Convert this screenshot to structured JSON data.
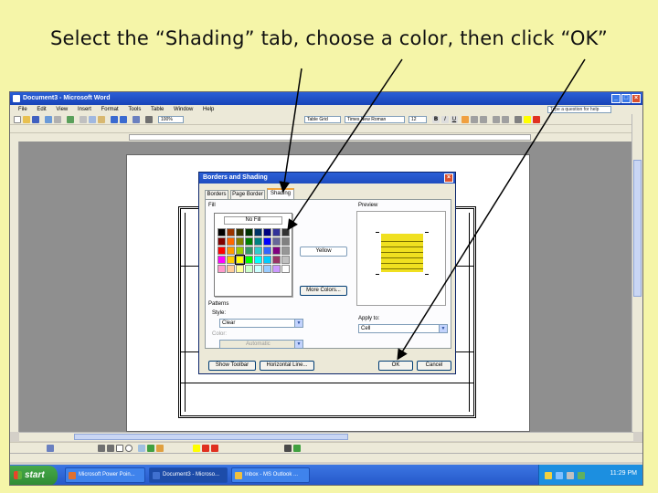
{
  "caption": "Select the “Shading” tab, choose a color, then click “OK”",
  "window": {
    "title": "Document3 - Microsoft Word",
    "menu": [
      "File",
      "Edit",
      "View",
      "Insert",
      "Format",
      "Tools",
      "Table",
      "Window",
      "Help"
    ],
    "help_placeholder": "Type a question for help",
    "style_box": "Table Grid",
    "font_box": "Times New Roman",
    "size_box": "12",
    "zoom_box": "100%"
  },
  "dialog": {
    "title": "Borders and Shading",
    "tabs": [
      "Borders",
      "Page Border",
      "Shading"
    ],
    "active_tab": "Shading",
    "fill_label": "Fill",
    "no_fill": "No Fill",
    "selected_color_name": "Yellow",
    "more_colors": "More Colors...",
    "patterns_label": "Patterns",
    "style_label": "Style:",
    "style_value": "Clear",
    "color_label": "Color:",
    "color_value": "Automatic",
    "preview_label": "Preview",
    "apply_to_label": "Apply to:",
    "apply_to_value": "Cell",
    "show_toolbar": "Show Toolbar",
    "horizontal_line": "Horizontal Line...",
    "ok": "OK",
    "cancel": "Cancel"
  },
  "palette": [
    "#000000",
    "#993300",
    "#333300",
    "#003300",
    "#003366",
    "#000080",
    "#333399",
    "#333333",
    "#800000",
    "#ff6600",
    "#808000",
    "#008000",
    "#008080",
    "#0000ff",
    "#666699",
    "#808080",
    "#ff0000",
    "#ff9900",
    "#99cc00",
    "#339966",
    "#33cccc",
    "#3366ff",
    "#800080",
    "#969696",
    "#ff00ff",
    "#ffcc00",
    "#ffff00",
    "#00ff00",
    "#00ffff",
    "#00ccff",
    "#993366",
    "#c0c0c0",
    "#ff99cc",
    "#ffcc99",
    "#ffff99",
    "#ccffcc",
    "#ccffff",
    "#99ccff",
    "#cc99ff",
    "#ffffff"
  ],
  "selected_swatch_index": 26,
  "taskbar": {
    "start": "start",
    "items": [
      "Microsoft Power Poin...",
      "Document3 - Microso...",
      "Inbox - MS Outlook ..."
    ],
    "clock": "11:29 PM"
  },
  "colors": {
    "slide_bg": "#f5f5a8",
    "xp_blue": "#2456c8",
    "selection": "#f0e020"
  }
}
